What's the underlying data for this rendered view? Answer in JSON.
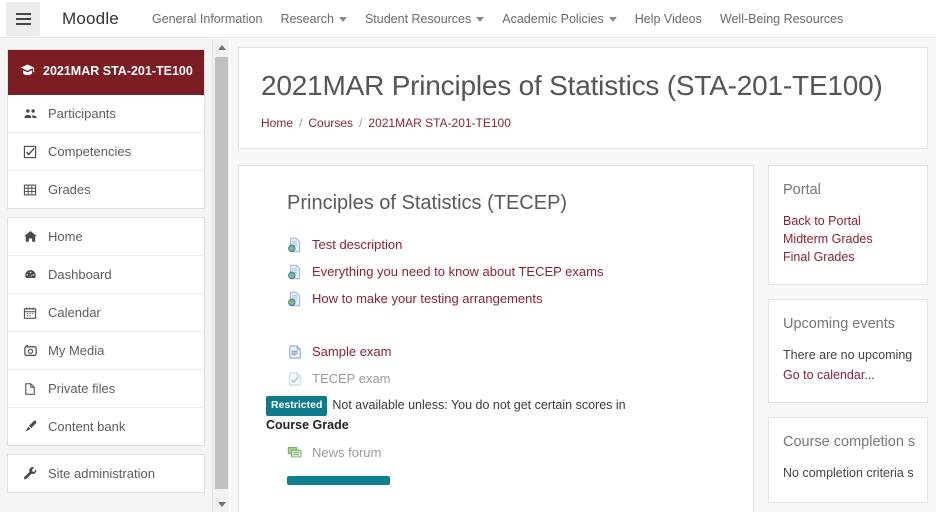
{
  "navbar": {
    "menu_icon": "hamburger-icon",
    "brand": "Moodle",
    "items": [
      {
        "label": "General Information",
        "has_dropdown": false
      },
      {
        "label": "Research",
        "has_dropdown": true
      },
      {
        "label": "Student Resources",
        "has_dropdown": true
      },
      {
        "label": "Academic Policies",
        "has_dropdown": true
      },
      {
        "label": "Help Videos",
        "has_dropdown": false
      },
      {
        "label": "Well-Being Resources",
        "has_dropdown": false
      }
    ]
  },
  "sidebar": {
    "course": {
      "label": "2021MAR STA-201-TE100",
      "icon": "graduation-cap-icon",
      "active_color": "#7b1d22"
    },
    "course_items": [
      {
        "label": "Participants",
        "icon": "users-icon"
      },
      {
        "label": "Competencies",
        "icon": "checkbox-icon"
      },
      {
        "label": "Grades",
        "icon": "table-icon"
      }
    ],
    "site_items": [
      {
        "label": "Home",
        "icon": "home-icon"
      },
      {
        "label": "Dashboard",
        "icon": "dashboard-icon"
      },
      {
        "label": "Calendar",
        "icon": "calendar-icon"
      },
      {
        "label": "My Media",
        "icon": "media-icon"
      },
      {
        "label": "Private files",
        "icon": "file-icon"
      },
      {
        "label": "Content bank",
        "icon": "brush-icon"
      }
    ],
    "admin_items": [
      {
        "label": "Site administration",
        "icon": "wrench-icon"
      }
    ],
    "scrollbar": {
      "up_icon": "scroll-up-arrow-icon",
      "down_icon": "scroll-down-arrow-icon"
    }
  },
  "header": {
    "title": "2021MAR Principles of Statistics (STA-201-TE100)",
    "breadcrumb": [
      {
        "label": "Home",
        "link": true
      },
      {
        "label": "Courses",
        "link": true
      },
      {
        "label": "2021MAR STA-201-TE100",
        "link": true
      }
    ],
    "breadcrumb_separator": "/"
  },
  "main": {
    "section_title": "Principles of Statistics (TECEP)",
    "activities_group_1": [
      {
        "label": "Test description",
        "icon": "url-page-globe-icon",
        "dimmed": false
      },
      {
        "label": "Everything you need to know about TECEP exams",
        "icon": "url-page-globe-icon",
        "dimmed": false
      },
      {
        "label": "How to make your testing arrangements",
        "icon": "url-page-globe-icon",
        "dimmed": false
      }
    ],
    "activities_group_2": [
      {
        "label": "Sample exam",
        "icon": "page-resource-icon",
        "dimmed": false
      },
      {
        "label": "TECEP exam",
        "icon": "quiz-icon",
        "dimmed": true
      }
    ],
    "restriction": {
      "badge": "Restricted",
      "badge_color": "#0f7b8a",
      "text_before": "Not available unless: You do not get certain scores in ",
      "text_bold": "Course Grade"
    },
    "activities_group_3": [
      {
        "label": "News forum",
        "icon": "forum-icon",
        "dimmed": true
      }
    ],
    "bottom_bar_color": "#0d7f8f"
  },
  "blocks": [
    {
      "title": "Portal",
      "links": [
        "Back to Portal",
        "Midterm Grades",
        "Final Grades"
      ],
      "paragraphs": []
    },
    {
      "title": "Upcoming events",
      "links": [
        "Go to calendar..."
      ],
      "paragraphs": [
        "There are no upcoming"
      ]
    },
    {
      "title": "Course completion s",
      "links": [],
      "paragraphs": [
        "No completion criteria s"
      ]
    }
  ]
}
